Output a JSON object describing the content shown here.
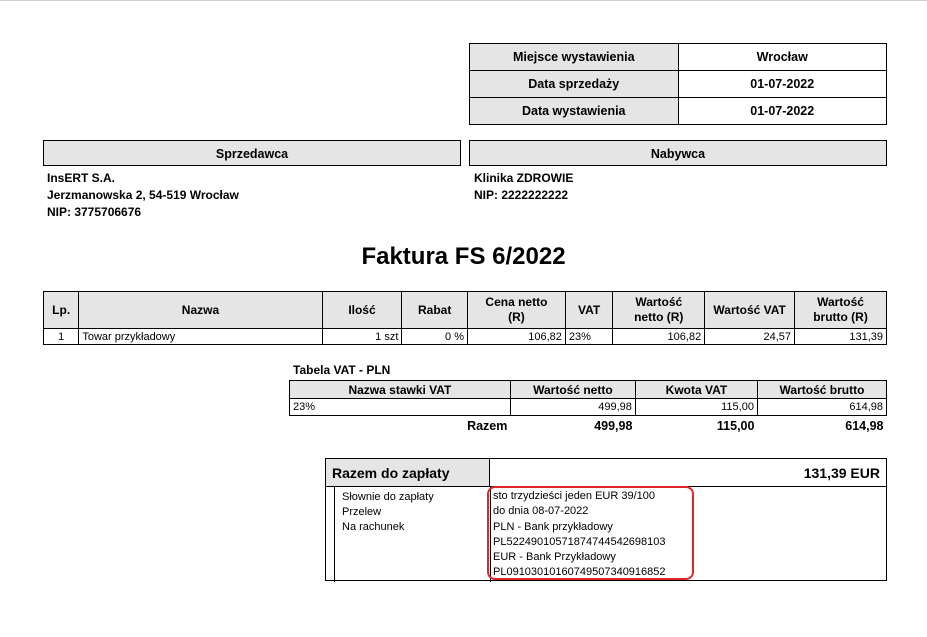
{
  "meta": {
    "rows": [
      {
        "label": "Miejsce wystawienia",
        "value": "Wrocław"
      },
      {
        "label": "Data sprzedaży",
        "value": "01-07-2022"
      },
      {
        "label": "Data wystawienia",
        "value": "01-07-2022"
      }
    ]
  },
  "seller": {
    "header": "Sprzedawca",
    "name": "InsERT S.A.",
    "address": "Jerzmanowska 2, 54-519 Wrocław",
    "nip": "NIP: 3775706676"
  },
  "buyer": {
    "header": "Nabywca",
    "name": "Klinika ZDROWIE",
    "nip": "NIP: 2222222222"
  },
  "title": "Faktura FS 6/2022",
  "items": {
    "headers": [
      "Lp.",
      "Nazwa",
      "Ilość",
      "Rabat",
      "Cena netto (R)",
      "VAT",
      "Wartość netto (R)",
      "Wartość VAT",
      "Wartość brutto (R)"
    ],
    "rows": [
      [
        "1",
        "Towar przykładowy",
        "1 szt",
        "0 %",
        "106,82",
        "23%",
        "106,82",
        "24,57",
        "131,39"
      ]
    ]
  },
  "vat_table": {
    "title": "Tabela VAT - PLN",
    "headers": [
      "Nazwa stawki VAT",
      "Wartość netto",
      "Kwota VAT",
      "Wartość brutto"
    ],
    "rows": [
      [
        "23%",
        "499,98",
        "115,00",
        "614,98"
      ]
    ],
    "sum": {
      "label": "Razem",
      "netto": "499,98",
      "vat": "115,00",
      "brutto": "614,98"
    }
  },
  "payment": {
    "label": "Razem do zapłaty",
    "amount": "131,39 EUR",
    "left_lines": [
      "Słownie do zapłaty",
      "Przelew",
      "Na rachunek"
    ],
    "right_lines": [
      "sto trzydzieści jeden EUR 39/100",
      "do dnia 08-07-2022",
      "PLN - Bank przykładowy",
      "PL52249010571874744542698103",
      "EUR - Bank Przykładowy",
      "PL09103010160749507340916852"
    ],
    "highlight_color": "#e0262b"
  }
}
